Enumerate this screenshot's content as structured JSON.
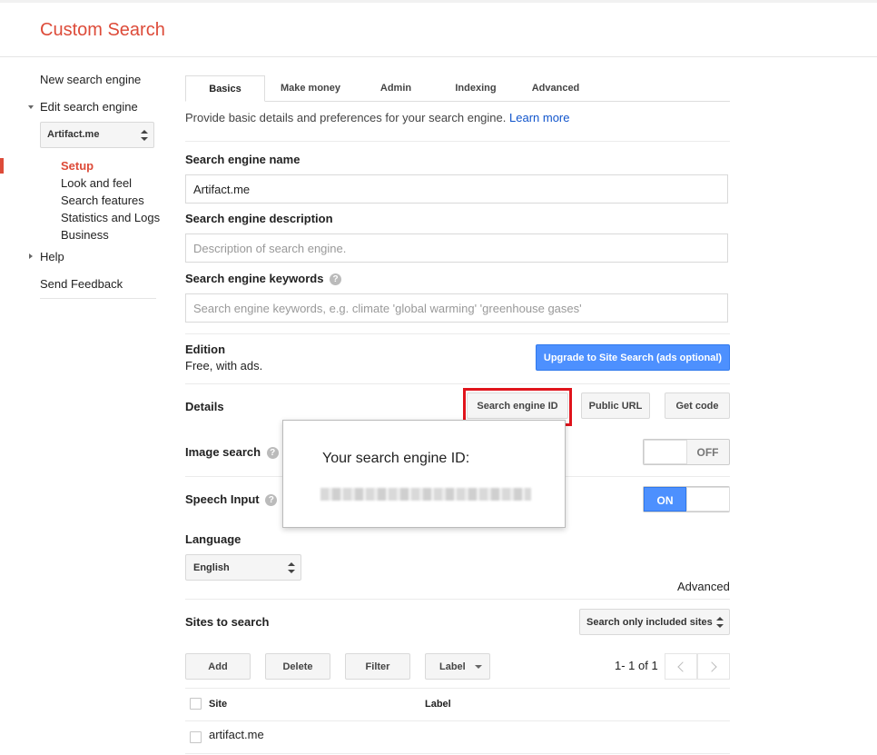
{
  "app": {
    "title": "Custom Search"
  },
  "sidebar": {
    "new_engine": "New search engine",
    "edit_engine": "Edit search engine",
    "engine_select": "Artifact.me",
    "items": [
      "Setup",
      "Look and feel",
      "Search features",
      "Statistics and Logs",
      "Business"
    ],
    "active_item": "Setup",
    "help": "Help",
    "feedback": "Send Feedback"
  },
  "tabs": [
    "Basics",
    "Make money",
    "Admin",
    "Indexing",
    "Advanced"
  ],
  "active_tab": "Basics",
  "intro": {
    "text": "Provide basic details and preferences for your search engine.",
    "link": "Learn more"
  },
  "form": {
    "name_label": "Search engine name",
    "name_value": "Artifact.me",
    "description_label": "Search engine description",
    "description_placeholder": "Description of search engine.",
    "keywords_label": "Search engine keywords",
    "keywords_placeholder": "Search engine keywords, e.g. climate 'global warming' 'greenhouse gases'"
  },
  "edition": {
    "label": "Edition",
    "value": "Free, with ads.",
    "upgrade_button": "Upgrade to Site Search (ads optional)"
  },
  "details": {
    "label": "Details",
    "id_button": "Search engine ID",
    "public_url_button": "Public URL",
    "get_code_button": "Get code"
  },
  "popup": {
    "title": "Your search engine ID:"
  },
  "image_search": {
    "label": "Image search",
    "toggle": "OFF"
  },
  "speech_input": {
    "label": "Speech Input",
    "toggle": "ON"
  },
  "language": {
    "label": "Language",
    "value": "English",
    "advanced_link": "Advanced"
  },
  "sites": {
    "label": "Sites to search",
    "filter_select": "Search only included sites",
    "buttons": {
      "add": "Add",
      "delete": "Delete",
      "filter": "Filter",
      "label": "Label"
    },
    "pagination": "1- 1 of 1",
    "columns": {
      "site": "Site",
      "label": "Label"
    },
    "rows": [
      {
        "site": "artifact.me",
        "label": ""
      }
    ]
  },
  "icons": {
    "help": "question-circle-icon",
    "prev": "chevron-left-icon",
    "next": "chevron-right-icon"
  },
  "colors": {
    "brand": "#dd4b39",
    "primary_button": "#4d90fe",
    "link": "#1155cc",
    "highlight": "#e0141c"
  }
}
